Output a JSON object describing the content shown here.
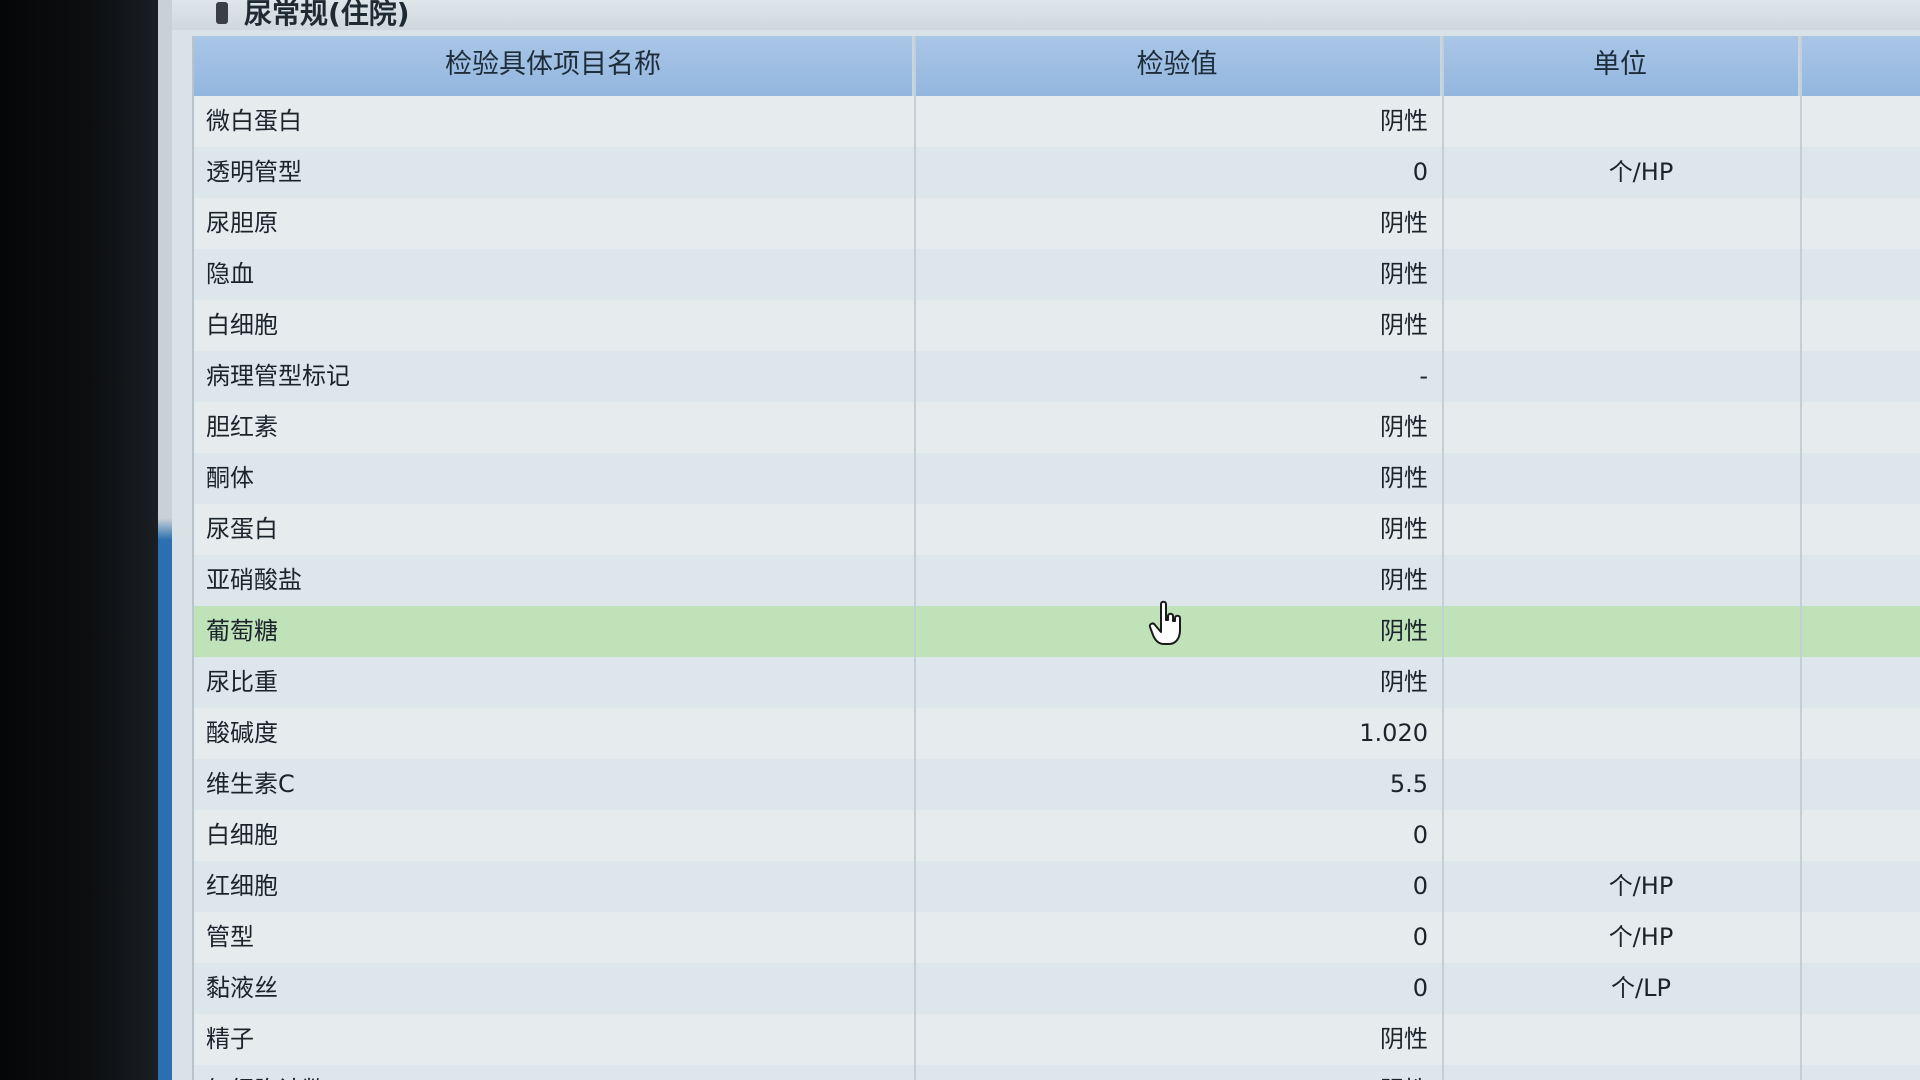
{
  "window": {
    "title": "尿常规(住院)"
  },
  "table": {
    "columns": [
      "检验具体项目名称",
      "检验值",
      "单位",
      ""
    ],
    "rows": [
      {
        "name": "微白蛋白",
        "value": "阴性",
        "unit": ""
      },
      {
        "name": "透明管型",
        "value": "0",
        "unit": "个/HP"
      },
      {
        "name": "尿胆原",
        "value": "阴性",
        "unit": ""
      },
      {
        "name": "隐血",
        "value": "阴性",
        "unit": ""
      },
      {
        "name": "白细胞",
        "value": "阴性",
        "unit": ""
      },
      {
        "name": "病理管型标记",
        "value": "-",
        "unit": ""
      },
      {
        "name": "胆红素",
        "value": "阴性",
        "unit": ""
      },
      {
        "name": "酮体",
        "value": "阴性",
        "unit": ""
      },
      {
        "name": "尿蛋白",
        "value": "阴性",
        "unit": ""
      },
      {
        "name": "亚硝酸盐",
        "value": "阴性",
        "unit": ""
      },
      {
        "name": "葡萄糖",
        "value": "阴性",
        "unit": ""
      },
      {
        "name": "尿比重",
        "value": "阴性",
        "unit": ""
      },
      {
        "name": "酸碱度",
        "value": "1.020",
        "unit": ""
      },
      {
        "name": "维生素C",
        "value": "5.5",
        "unit": ""
      },
      {
        "name": "白细胞",
        "value": "0",
        "unit": ""
      },
      {
        "name": "红细胞",
        "value": "0",
        "unit": "个/HP"
      },
      {
        "name": "管型",
        "value": "0",
        "unit": "个/HP"
      },
      {
        "name": "黏液丝",
        "value": "0",
        "unit": "个/LP"
      },
      {
        "name": "精子",
        "value": "阴性",
        "unit": ""
      },
      {
        "name": "红细胞计数",
        "value": "阴性",
        "unit": ""
      }
    ],
    "selected_row": 10
  },
  "colors": {
    "header_bg": "#9dbde2",
    "selected_row": "#bfe2b9"
  },
  "icons": {
    "cursor": "hand-pointer-icon"
  }
}
